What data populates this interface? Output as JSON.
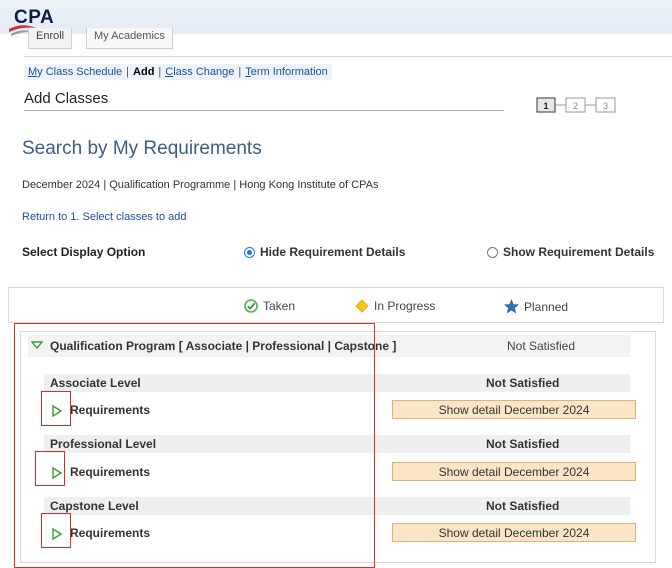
{
  "logo": {
    "text": "CPA"
  },
  "tabs": [
    "Enroll",
    "My Academics"
  ],
  "subnav": {
    "items": [
      {
        "label": "My Class Schedule",
        "link": true,
        "current": false
      },
      {
        "label": "Add",
        "link": false,
        "current": true
      },
      {
        "label": "Class Change",
        "link": true,
        "current": false
      },
      {
        "label": "Term Information",
        "link": true,
        "current": false
      }
    ],
    "separator": "|"
  },
  "page_title": "Add Classes",
  "steps": [
    "1",
    "2",
    "3"
  ],
  "section_title": "Search by My Requirements",
  "context_line": "December 2024 | Qualification Programme | Hong Kong Institute of CPAs",
  "return_link": "Return to 1. Select classes to add",
  "display_option": {
    "label": "Select Display Option",
    "options": [
      {
        "label": "Hide Requirement Details",
        "selected": true
      },
      {
        "label": "Show Requirement Details",
        "selected": false
      }
    ]
  },
  "legend": {
    "taken": "Taken",
    "in_progress": "In Progress",
    "planned": "Planned",
    "colors": {
      "taken": "#4caf50",
      "in_progress": "#f5c518",
      "planned": "#2f6fc2"
    }
  },
  "program": {
    "title": "Qualification Program [ Associate | Professional | Capstone ]",
    "status": "Not Satisfied",
    "levels": [
      {
        "name": "Associate Level",
        "status": "Not Satisfied",
        "requirement_label": "Requirements",
        "detail_button": "Show detail December 2024"
      },
      {
        "name": "Professional Level",
        "status": "Not Satisfied",
        "requirement_label": "Requirements",
        "detail_button": "Show detail December 2024"
      },
      {
        "name": "Capstone Level",
        "status": "Not Satisfied",
        "requirement_label": "Requirements",
        "detail_button": "Show detail December 2024"
      }
    ]
  },
  "colors": {
    "accent_link": "#1f4ea3",
    "title_blue": "#3b5d8a",
    "button_bg": "#fbe5c7",
    "highlight": "#d0312d"
  }
}
